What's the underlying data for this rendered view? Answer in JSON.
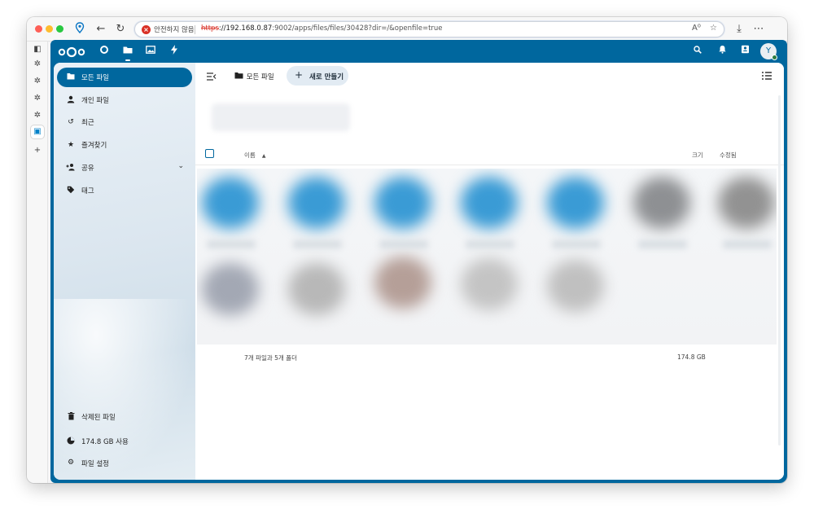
{
  "browser": {
    "security_label": "안전하지 않음",
    "url_scheme": "https",
    "url_host": "://192.168.0.87",
    "url_rest": ":9002/apps/files/files/30428?dir=/&openfile=true",
    "reader_icon": "A⁰"
  },
  "header": {
    "apps": [
      {
        "name": "dashboard",
        "icon": "circle-icon"
      },
      {
        "name": "files",
        "icon": "folder-icon"
      },
      {
        "name": "photos",
        "icon": "image-icon"
      },
      {
        "name": "activity",
        "icon": "bolt-icon"
      }
    ],
    "avatar_initial": "Y"
  },
  "sidebar": {
    "items": [
      {
        "label": "모든 파일",
        "icon": "folder-icon"
      },
      {
        "label": "개인 파일",
        "icon": "user-icon"
      },
      {
        "label": "최근",
        "icon": "history-icon"
      },
      {
        "label": "즐겨찾기",
        "icon": "star-icon"
      },
      {
        "label": "공유",
        "icon": "share-icon"
      },
      {
        "label": "태그",
        "icon": "tag-icon"
      }
    ],
    "footer": [
      {
        "label": "삭제된 파일",
        "icon": "trash-icon"
      },
      {
        "label": "174.8 GB 사용",
        "icon": "pie-icon"
      },
      {
        "label": "파일 설정",
        "icon": "gear-icon"
      }
    ]
  },
  "main": {
    "breadcrumb": "모든 파일",
    "new_button": "새로 만들기",
    "columns": {
      "name": "이름",
      "size": "크기",
      "modified": "수정됨"
    },
    "summary_count": "7개 파일과 5개 폴더",
    "summary_size": "174.8 GB"
  },
  "colors": {
    "brand": "#00679e",
    "folder": "#3a9bd5",
    "security": "#d93025"
  }
}
